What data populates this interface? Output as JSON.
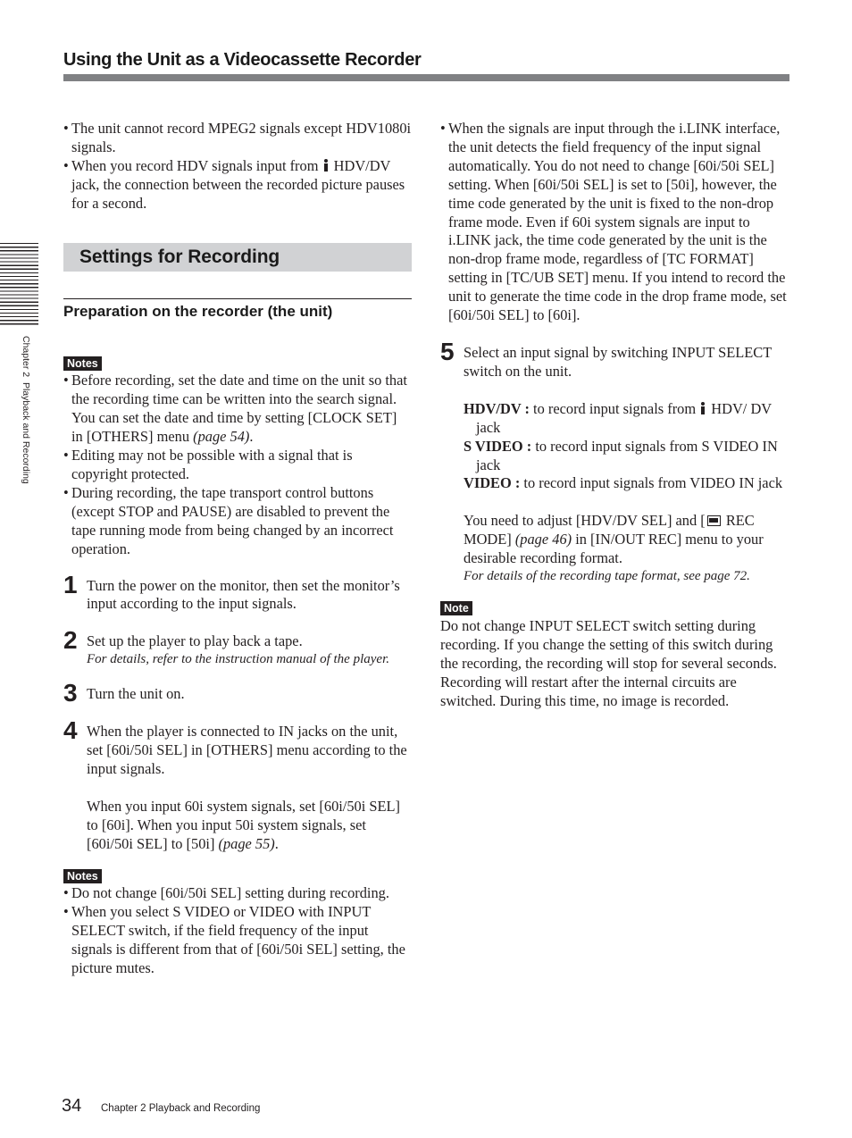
{
  "header": {
    "title": "Using the Unit as a Videocassette Recorder"
  },
  "side_tab": {
    "label": "Chapter 2  Playback and Recording"
  },
  "left_column": {
    "intro_bullets": [
      {
        "text": "The unit cannot record MPEG2 signals except HDV1080i signals."
      },
      {
        "before_icon": "When you record HDV signals input from ",
        "icon": "ilink-icon",
        "after_icon": " HDV/DV jack, the connection between the recorded picture pauses for a second."
      }
    ],
    "section_title": "Settings for Recording",
    "subsection_title": "Preparation on the recorder (the unit)",
    "notes_1": {
      "badge": "Notes",
      "items": [
        {
          "text": "Before recording, set the date and time on the unit so that the recording time can be written into the search signal. You can set the date and time by setting [CLOCK SET] in [OTHERS] menu ",
          "ref": "(page 54)",
          "tail": "."
        },
        {
          "text": "Editing may not be possible with a signal that is copyright protected."
        },
        {
          "text": "During recording, the tape transport control buttons (except STOP and PAUSE) are disabled to prevent the tape running mode from being changed by an incorrect operation."
        }
      ]
    },
    "steps": [
      {
        "num": "1",
        "text": "Turn the power on the monitor, then set the monitor’s input according to the input signals."
      },
      {
        "num": "2",
        "text": "Set up the player to play back a tape.",
        "note": "For details, refer to the instruction manual of the player."
      },
      {
        "num": "3",
        "text": "Turn the unit on."
      },
      {
        "num": "4",
        "text": "When the player is connected to IN jacks on the unit, set [60i/50i SEL] in [OTHERS] menu according to the input signals.",
        "para2": "When you input 60i system signals, set [60i/50i SEL] to [60i]. When you input 50i system signals, set [60i/50i SEL] to [50i] ",
        "para2_ref": "(page 55)",
        "para2_tail": "."
      }
    ],
    "notes_2": {
      "badge": "Notes",
      "items": [
        {
          "text": "Do not change [60i/50i SEL] setting during recording."
        },
        {
          "text": "When you select S VIDEO or VIDEO with INPUT SELECT switch, if the field frequency of the input signals is different from that of [60i/50i SEL] setting, the picture mutes."
        }
      ]
    }
  },
  "right_column": {
    "bullet": {
      "text": "When the signals are input through the i.LINK interface, the unit detects the field frequency of the input signal automatically. You do not need to change [60i/50i SEL] setting. When [60i/50i SEL] is set to [50i], however, the time code generated by the unit is fixed to the non-drop frame mode. Even if 60i system signals are input to i.LINK jack, the time code generated by the unit is the non-drop frame mode, regardless of [TC FORMAT] setting in [TC/UB SET] menu. If you intend to record the unit to generate the time code in the drop frame mode, set [60i/50i SEL] to [60i]."
    },
    "step5": {
      "num": "5",
      "text": "Select an input signal by switching INPUT SELECT switch on the unit.",
      "options": [
        {
          "term": "HDV/DV :",
          "before_icon": " to record input signals from ",
          "icon": "ilink-icon",
          "after_icon": " HDV/ DV jack"
        },
        {
          "term": "S VIDEO :",
          "desc": " to record input signals from S VIDEO IN jack"
        },
        {
          "term": "VIDEO :",
          "desc": " to record input signals from VIDEO IN jack"
        }
      ],
      "adjust_before_icon": "You need to adjust [HDV/DV SEL] and [",
      "adjust_icon": "cassette-icon",
      "adjust_after_icon": " REC MODE] ",
      "adjust_ref": "(page 46)",
      "adjust_tail": " in [IN/OUT REC] menu to your desirable recording format.",
      "note": "For details of the recording tape format, see page 72."
    },
    "note": {
      "badge": "Note",
      "text": "Do not change INPUT SELECT switch setting during recording. If you change the setting of this switch during the recording, the recording will stop for several seconds. Recording will restart after the internal circuits are switched. During this time, no image is recorded."
    }
  },
  "footer": {
    "page_number": "34",
    "chapter": "Chapter 2   Playback and Recording"
  }
}
